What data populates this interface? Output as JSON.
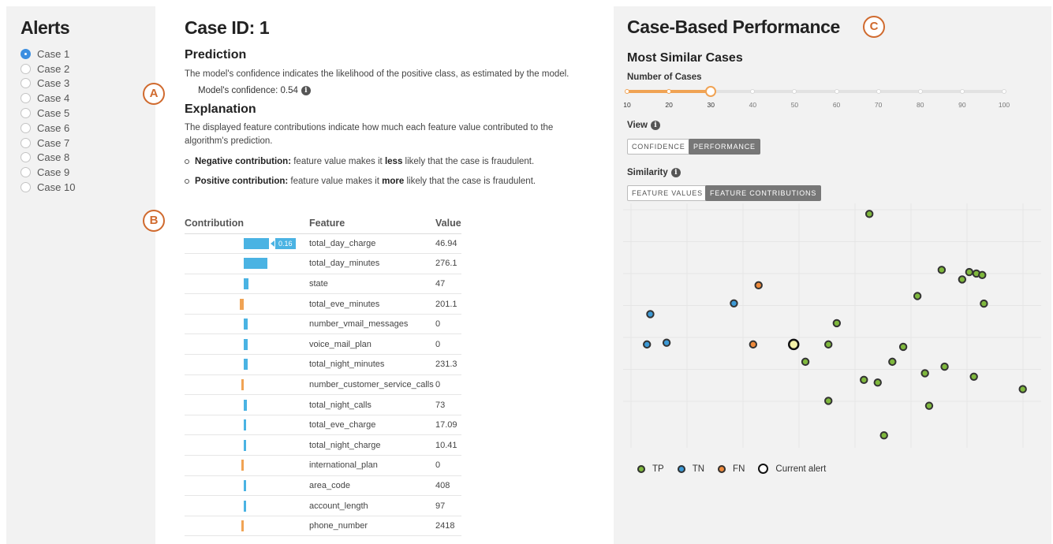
{
  "alerts": {
    "title": "Alerts",
    "cases": [
      "Case 1",
      "Case 2",
      "Case 3",
      "Case 4",
      "Case 5",
      "Case 6",
      "Case 7",
      "Case 8",
      "Case 9",
      "Case 10"
    ],
    "selected_index": 0
  },
  "case": {
    "title": "Case ID: 1",
    "prediction_heading": "Prediction",
    "prediction_text": "The model's confidence indicates the likelihood of the positive class, as estimated by the model.",
    "confidence_label": "Model's confidence: 0.54",
    "explanation_heading": "Explanation",
    "explanation_text": "The displayed feature contributions indicate how much each feature value contributed to the algorithm's prediction.",
    "negative_label": "Negative contribution:",
    "negative_pre": "feature value makes it",
    "negative_bold": "less",
    "negative_post": "likely that the case is fraudulent.",
    "positive_label": "Positive contribution:",
    "positive_pre": "feature value makes it",
    "positive_bold": "more",
    "positive_post": "likely that the case is fraudulent."
  },
  "markers": {
    "a": "A",
    "b": "B",
    "c": "C"
  },
  "contrib_table": {
    "headers": {
      "contribution": "Contribution",
      "feature": "Feature",
      "value": "Value"
    },
    "tooltip": "0.16",
    "rows": [
      {
        "feature": "total_day_charge",
        "value": "46.94",
        "contribution": 0.16
      },
      {
        "feature": "total_day_minutes",
        "value": "276.1",
        "contribution": 0.15
      },
      {
        "feature": "state",
        "value": "47",
        "contribution": 0.03
      },
      {
        "feature": "total_eve_minutes",
        "value": "201.1",
        "contribution": -0.025
      },
      {
        "feature": "number_vmail_messages",
        "value": "0",
        "contribution": 0.025
      },
      {
        "feature": "voice_mail_plan",
        "value": "0",
        "contribution": 0.025
      },
      {
        "feature": "total_night_minutes",
        "value": "231.3",
        "contribution": 0.025
      },
      {
        "feature": "number_customer_service_calls",
        "value": "0",
        "contribution": -0.015
      },
      {
        "feature": "total_night_calls",
        "value": "73",
        "contribution": 0.02
      },
      {
        "feature": "total_eve_charge",
        "value": "17.09",
        "contribution": 0.01
      },
      {
        "feature": "total_night_charge",
        "value": "10.41",
        "contribution": 0.01
      },
      {
        "feature": "international_plan",
        "value": "0",
        "contribution": -0.01
      },
      {
        "feature": "area_code",
        "value": "408",
        "contribution": 0.01
      },
      {
        "feature": "account_length",
        "value": "97",
        "contribution": 0.01
      },
      {
        "feature": "phone_number",
        "value": "2418",
        "contribution": -0.01
      }
    ]
  },
  "perf": {
    "title": "Case-Based Performance",
    "subtitle": "Most Similar Cases",
    "num_cases_label": "Number of Cases",
    "slider_ticks": [
      "10",
      "20",
      "30",
      "40",
      "50",
      "60",
      "70",
      "80",
      "90",
      "100"
    ],
    "slider_value": 30,
    "view_label": "View",
    "view_buttons": [
      "CONFIDENCE",
      "PERFORMANCE"
    ],
    "view_active": "PERFORMANCE",
    "similarity_label": "Similarity",
    "similarity_buttons": [
      "FEATURE VALUES",
      "FEATURE CONTRIBUTIONS"
    ],
    "similarity_active": "FEATURE CONTRIBUTIONS",
    "legend": {
      "tp": "TP",
      "tn": "TN",
      "fn": "FN",
      "current": "Current alert"
    },
    "colors": {
      "tp": "#7fb83d",
      "tn": "#3d9ad6",
      "fn": "#ee8a3c",
      "current": "#f4f1a8",
      "outline": "#333333"
    }
  },
  "chart_data": {
    "type": "scatter",
    "title": "",
    "xlabel": "",
    "ylabel": "",
    "xlim": [
      0,
      1
    ],
    "ylim": [
      0,
      1
    ],
    "grid": true,
    "legend_position": "bottom-left",
    "series": [
      {
        "name": "TP",
        "points": [
          [
            0.589,
            0.957
          ],
          [
            0.762,
            0.728
          ],
          [
            0.828,
            0.719
          ],
          [
            0.845,
            0.713
          ],
          [
            0.859,
            0.707
          ],
          [
            0.811,
            0.689
          ],
          [
            0.704,
            0.621
          ],
          [
            0.863,
            0.59
          ],
          [
            0.511,
            0.51
          ],
          [
            0.491,
            0.423
          ],
          [
            0.67,
            0.413
          ],
          [
            0.436,
            0.352
          ],
          [
            0.644,
            0.352
          ],
          [
            0.769,
            0.332
          ],
          [
            0.722,
            0.305
          ],
          [
            0.839,
            0.291
          ],
          [
            0.576,
            0.278
          ],
          [
            0.609,
            0.267
          ],
          [
            0.956,
            0.24
          ],
          [
            0.491,
            0.192
          ],
          [
            0.732,
            0.172
          ],
          [
            0.624,
            0.051
          ]
        ]
      },
      {
        "name": "TN",
        "points": [
          [
            0.265,
            0.591
          ],
          [
            0.065,
            0.547
          ],
          [
            0.057,
            0.423
          ],
          [
            0.104,
            0.43
          ]
        ]
      },
      {
        "name": "FN",
        "points": [
          [
            0.324,
            0.665
          ],
          [
            0.311,
            0.423
          ]
        ]
      },
      {
        "name": "Current alert",
        "points": [
          [
            0.408,
            0.423
          ]
        ]
      }
    ]
  }
}
